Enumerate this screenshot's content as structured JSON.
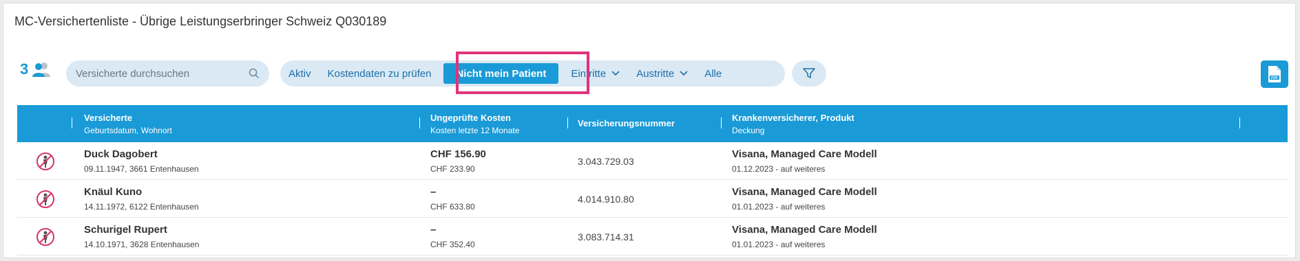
{
  "header": {
    "title": "MC-Versichertenliste - Übrige Leistungserbringer Schweiz Q030189"
  },
  "toolbar": {
    "count": "3",
    "search_placeholder": "Versicherte durchsuchen",
    "tabs": [
      {
        "label": "Aktiv"
      },
      {
        "label": "Kostendaten zu prüfen"
      },
      {
        "label": "Nicht mein Patient"
      },
      {
        "label": "Eintritte"
      },
      {
        "label": "Austritte"
      },
      {
        "label": "Alle"
      }
    ]
  },
  "colors": {
    "accent": "#1a9ad6",
    "highlight": "#e0337b",
    "tab_bg": "#dbe9f4"
  },
  "table": {
    "columns": [
      {
        "title": "Versicherte",
        "subtitle": "Geburtsdatum, Wohnort"
      },
      {
        "title": "Ungeprüfte Kosten",
        "subtitle": "Kosten letzte 12 Monate"
      },
      {
        "title": "Versicherungsnummer",
        "subtitle": ""
      },
      {
        "title": "Krankenversicherer, Produkt",
        "subtitle": "Deckung"
      }
    ],
    "rows": [
      {
        "name": "Duck Dagobert",
        "info": "09.11.1947, 3661 Entenhausen",
        "cost": "CHF 156.90",
        "cost12": "CHF 233.90",
        "number": "3.043.729.03",
        "insurer": "Visana, Managed Care Modell",
        "coverage": "01.12.2023 - auf weiteres",
        "icon": "not-my-patient-icon"
      },
      {
        "name": "Knäul Kuno",
        "info": "14.11.1972, 6122 Entenhausen",
        "cost": "–",
        "cost12": "CHF 633.80",
        "number": "4.014.910.80",
        "insurer": "Visana, Managed Care Modell",
        "coverage": "01.01.2023 - auf weiteres",
        "icon": "not-my-patient-icon"
      },
      {
        "name": "Schurigel Rupert",
        "info": "14.10.1971, 3628 Entenhausen",
        "cost": "–",
        "cost12": "CHF 352.40",
        "number": "3.083.714.31",
        "insurer": "Visana, Managed Care Modell",
        "coverage": "01.01.2023 - auf weiteres",
        "icon": "not-my-patient-icon"
      }
    ]
  }
}
